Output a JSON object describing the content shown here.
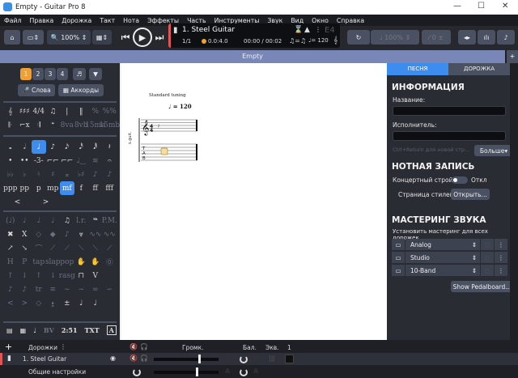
{
  "window": {
    "title": "Empty - Guitar Pro 8",
    "minimize": "—",
    "maximize": "☐",
    "close": "✕"
  },
  "menu": [
    "Файл",
    "Правка",
    "Дорожка",
    "Такт",
    "Нота",
    "Эффекты",
    "Часть",
    "Инструменты",
    "Звук",
    "Вид",
    "Окно",
    "Справка"
  ],
  "toolbar": {
    "zoom": "100%",
    "speed": "100%",
    "capo": "0"
  },
  "lcd": {
    "track": "1. Steel Guitar",
    "bar": "1/1",
    "position": "0.0:4.0",
    "time": "00:00 / 00:02",
    "tempo": "= 120",
    "key": "E4"
  },
  "doc_tab": "Empty",
  "palette": {
    "voices": [
      "1",
      "2",
      "3",
      "4"
    ],
    "lyrics": "Слова",
    "chords": "Аккорды",
    "dynamics": [
      "ppp",
      "pp",
      "p",
      "mp",
      "mf",
      "f",
      "ff",
      "fff"
    ],
    "text_tools": [
      "BV",
      "2:51",
      "TXT",
      "A"
    ]
  },
  "score": {
    "tuning": "Standard tuning",
    "tempo": "= 120",
    "track_label": "s.guit.",
    "tab": "TAB"
  },
  "right": {
    "tabs": [
      "ПЕСНЯ",
      "ДОРОЖКА"
    ],
    "info_title": "ИНФОРМАЦИЯ",
    "name_label": "Название:",
    "name_value": "",
    "artist_label": "Исполнитель:",
    "artist_value": "",
    "hint": "Ctrl+Return для новой стр...",
    "more": "Больше",
    "notation_title": "НОТНАЯ ЗАПИСЬ",
    "concert_label": "Концертный строй:",
    "concert_state": "Откл",
    "stylesheet_label": "Страница стилей:",
    "open": "Открыть...",
    "mastering_title": "МАСТЕРИНГ ЗВУКА",
    "mastering_hint": "Установить  мастеринг для всех дорожек",
    "presets": [
      "Analog",
      "Studio",
      "10-Band"
    ],
    "pedalboard": "Show Pedalboard..."
  },
  "tracks": {
    "header": "Дорожки",
    "volume": "Громк.",
    "balance": "Бал.",
    "eq": "Экв.",
    "bar_num": "1",
    "rows": [
      {
        "name": "1. Steel Guitar",
        "color": "#e05555"
      }
    ],
    "master": "Общие настройки"
  }
}
